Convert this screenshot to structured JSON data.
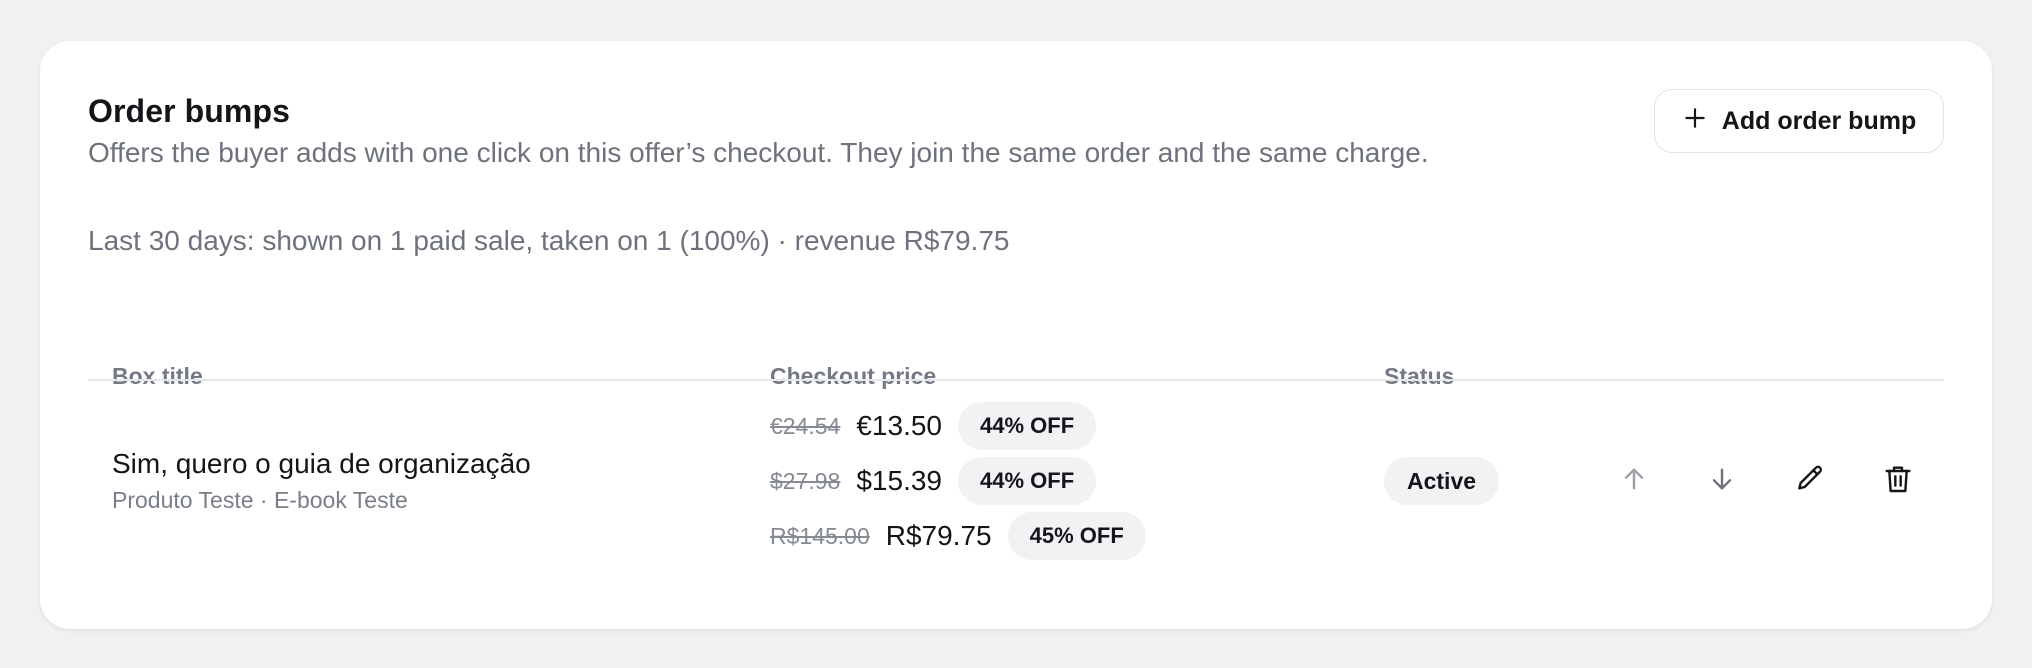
{
  "section": {
    "title": "Order bumps",
    "subtitle": "Offers the buyer adds with one click on this offer’s checkout. They join the same order and the same charge.",
    "add_button_label": "Add order bump",
    "stats": "Last 30 days: shown on 1 paid sale, taken on 1 (100%) · revenue R$79.75"
  },
  "table": {
    "columns": [
      "Box title",
      "Checkout price",
      "Status"
    ],
    "rows": [
      {
        "title": "Sim, quero o guia de organização",
        "subtitle": "Produto Teste · E-book Teste",
        "prices": [
          {
            "original": "€24.54",
            "price": "€13.50",
            "discount": "44% OFF"
          },
          {
            "original": "$27.98",
            "price": "$15.39",
            "discount": "44% OFF"
          },
          {
            "original": "R$145.00",
            "price": "R$79.75",
            "discount": "45% OFF"
          }
        ],
        "status": "Active",
        "actions": [
          "arrow-up-icon",
          "arrow-down-icon",
          "pencil-icon",
          "trash-icon"
        ]
      }
    ]
  },
  "colors": {
    "page_background": "#f0f1f3",
    "card_background": "#ffffff",
    "muted_text": "#6e727c",
    "pill_background": "#f1f2f4"
  }
}
